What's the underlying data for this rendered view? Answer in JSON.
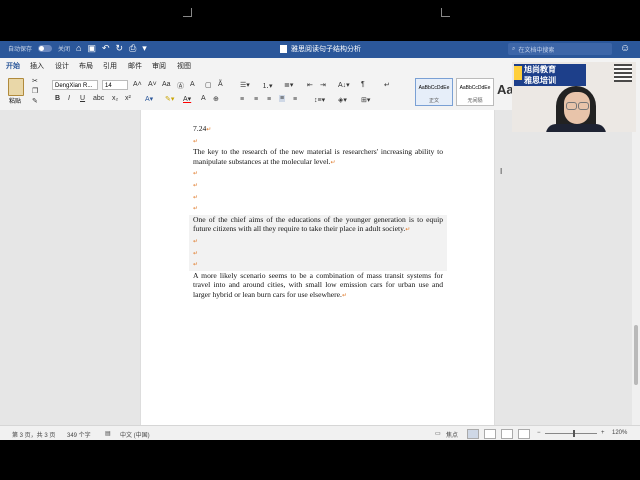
{
  "titlebar": {
    "autosave_label": "自动保存",
    "autosave_state": "关闭",
    "doc_title": "雅思阅读句子结构分析",
    "search_placeholder": "在文档中搜索"
  },
  "menu": {
    "tabs": [
      "开始",
      "插入",
      "设计",
      "布局",
      "引用",
      "邮件",
      "审阅",
      "视图"
    ],
    "active_tab": "开始"
  },
  "ribbon": {
    "paste_label": "粘贴",
    "font_name": "DengXian R...",
    "font_size": "14",
    "styles": [
      {
        "sample": "AaBbCcDdEe",
        "name": "正文"
      },
      {
        "sample": "AaBbCcDdEe",
        "name": "无间隔"
      },
      {
        "sample": "Aa",
        "name": ""
      }
    ]
  },
  "document": {
    "date": "7.24",
    "para1": "The key to the research of the new material is researchers' increasing ability to manipulate substances at the molecular level.",
    "para2": "One of the chief aims of the educations of the younger generation is to equip future citizens with all they require to take their place in adult society.",
    "para3": "A more likely scenario seems to be a combination of mass transit systems for travel into and around cities, with small low emission cars for urban use and larger hybrid or lean burn cars for use elsewhere.",
    "paragraph_mark": "↵"
  },
  "statusbar": {
    "page_info": "第 3 页，共 3 页",
    "word_count": "349 个字",
    "language": "中文 (中国)",
    "focus_label": "焦点",
    "zoom": "120%"
  },
  "webcam": {
    "logo_line1": "旭尚教育",
    "logo_line2": "雅思培训"
  },
  "colors": {
    "titlebar": "#2b579a",
    "accent": "#2b579a"
  }
}
